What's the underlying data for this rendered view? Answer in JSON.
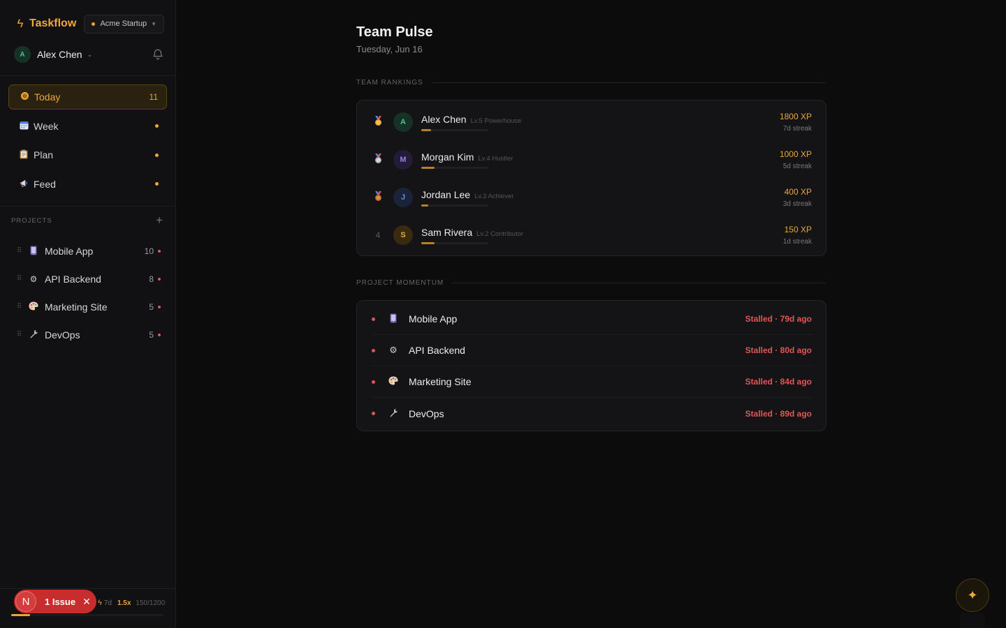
{
  "app": {
    "name": "Taskflow",
    "workspace": "Acme Startup"
  },
  "user": {
    "initial": "A",
    "name": "Alex Chen"
  },
  "nav": [
    {
      "label": "Today",
      "icon": "target-icon",
      "count": "11",
      "active": true
    },
    {
      "label": "Week",
      "icon": "calendar-icon",
      "dot": true
    },
    {
      "label": "Plan",
      "icon": "clipboard-icon",
      "dot": true
    },
    {
      "label": "Feed",
      "icon": "megaphone-icon",
      "dot": true
    }
  ],
  "projects_label": "PROJECTS",
  "projects": [
    {
      "name": "Mobile App",
      "icon": "phone-icon",
      "count": "10"
    },
    {
      "name": "API Backend",
      "icon": "gear-icon",
      "count": "8"
    },
    {
      "name": "Marketing Site",
      "icon": "palette-icon",
      "count": "5"
    },
    {
      "name": "DevOps",
      "icon": "wrench-icon",
      "count": "5"
    }
  ],
  "footer": {
    "streak_days": "7d",
    "multiplier": "1.5x",
    "xp": "150/1200",
    "progress": 0.125
  },
  "issue": {
    "initial": "N",
    "label": "1 Issue"
  },
  "page": {
    "title": "Team Pulse",
    "date": "Tuesday, Jun 16"
  },
  "rankings_label": "TEAM RANKINGS",
  "rankings": [
    {
      "rank": "1",
      "medal": "gold-medal-icon",
      "initial": "A",
      "name": "Alex Chen",
      "level": "Lv.5 Powerhouse",
      "xp": "1800 XP",
      "streak": "7d streak",
      "progress": 0.15,
      "color": "#46c489",
      "bg": "#163227"
    },
    {
      "rank": "2",
      "medal": "silver-medal-icon",
      "initial": "M",
      "name": "Morgan Kim",
      "level": "Lv.4 Hustler",
      "xp": "1000 XP",
      "streak": "5d streak",
      "progress": 0.2,
      "color": "#9a7ce8",
      "bg": "#231c38"
    },
    {
      "rank": "3",
      "medal": "bronze-medal-icon",
      "initial": "J",
      "name": "Jordan Lee",
      "level": "Lv.3 Achiever",
      "xp": "400 XP",
      "streak": "3d streak",
      "progress": 0.1,
      "color": "#5b8ee8",
      "bg": "#1a2338"
    },
    {
      "rank": "4",
      "medal": "",
      "initial": "S",
      "name": "Sam Rivera",
      "level": "Lv.2 Contributor",
      "xp": "150 XP",
      "streak": "1d streak",
      "progress": 0.2,
      "color": "#e9a73a",
      "bg": "#3a2a10"
    }
  ],
  "momentum_label": "PROJECT MOMENTUM",
  "momentum": [
    {
      "name": "Mobile App",
      "icon": "phone-icon",
      "status": "Stalled · 79d ago"
    },
    {
      "name": "API Backend",
      "icon": "gear-icon",
      "status": "Stalled · 80d ago"
    },
    {
      "name": "Marketing Site",
      "icon": "palette-icon",
      "status": "Stalled · 84d ago"
    },
    {
      "name": "DevOps",
      "icon": "wrench-icon",
      "status": "Stalled · 89d ago"
    }
  ],
  "colors": {
    "accent": "#f0a93a",
    "danger": "#e25555",
    "background": "#0c0c0d"
  }
}
